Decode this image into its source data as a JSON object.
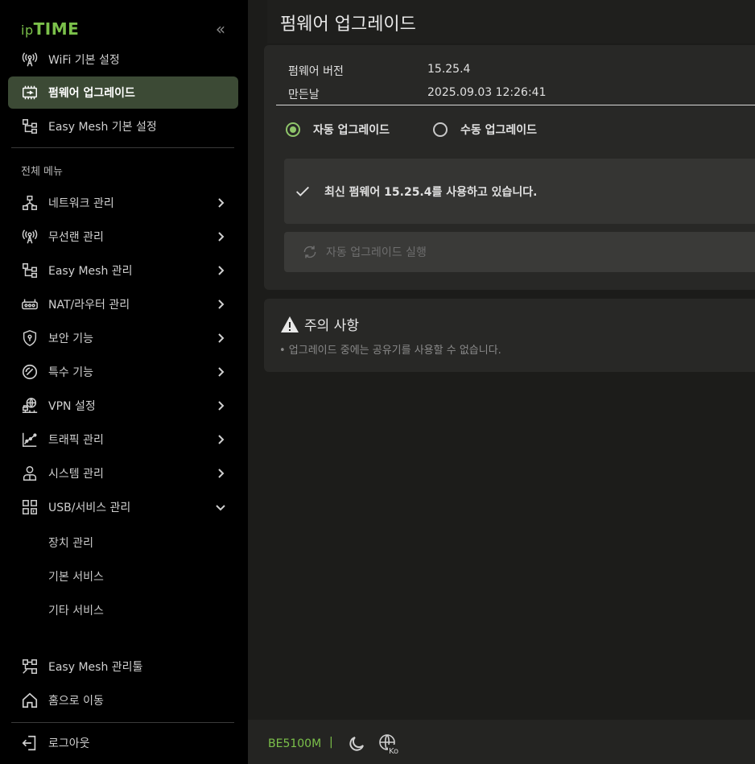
{
  "brand": {
    "logo_prefix": "ip",
    "logo_main": "TIME",
    "accent": "#7bc04a"
  },
  "sidebar": {
    "collapse_glyph": "«",
    "quick": [
      {
        "label": "WiFi 기본 설정",
        "icon": "antenna-icon"
      },
      {
        "label": "펌웨어 업그레이드",
        "icon": "firmware-chip-icon",
        "active": true
      },
      {
        "label": "Easy Mesh 기본 설정",
        "icon": "mesh-tree-icon"
      }
    ],
    "all_menu_label": "전체 메뉴",
    "menu": [
      {
        "label": "네트워크 관리",
        "icon": "network-icon"
      },
      {
        "label": "무선랜 관리",
        "icon": "antenna-icon"
      },
      {
        "label": "Easy Mesh 관리",
        "icon": "mesh-tree-icon"
      },
      {
        "label": "NAT/라우터 관리",
        "icon": "router-icon"
      },
      {
        "label": "보안 기능",
        "icon": "shield-icon"
      },
      {
        "label": "특수 기능",
        "icon": "gauge-icon"
      },
      {
        "label": "VPN 설정",
        "icon": "vpn-globe-icon"
      },
      {
        "label": "트래픽 관리",
        "icon": "traffic-chart-icon"
      },
      {
        "label": "시스템 관리",
        "icon": "system-user-icon"
      },
      {
        "label": "USB/서비스 관리",
        "icon": "usb-services-icon",
        "expanded": true
      }
    ],
    "sub_items": [
      "장치 관리",
      "기본 서비스",
      "기타 서비스"
    ],
    "bottom": [
      {
        "label": "Easy Mesh 관리툴",
        "icon": "mesh-tool-icon"
      },
      {
        "label": "홈으로 이동",
        "icon": "home-icon"
      },
      {
        "label": "로그아웃",
        "icon": "logout-icon"
      }
    ]
  },
  "main": {
    "title": "펌웨어 업그레이드",
    "firmware": {
      "version_label": "펌웨어 버전",
      "version_value": "15.25.4",
      "build_label": "만든날",
      "build_value": "2025.09.03 12:26:41"
    },
    "modes": [
      {
        "label": "자동 업그레이드",
        "checked": true
      },
      {
        "label": "수동 업그레이드",
        "checked": false
      }
    ],
    "status_message": "최신 펌웨어 15.25.4를 사용하고 있습니다.",
    "run_button_label": "자동 업그레이드 실행",
    "caution": {
      "title": "주의 사항",
      "items": [
        "• 업그레이드 중에는 공유기를 사용할 수 없습니다."
      ]
    }
  },
  "footer": {
    "model": "BE5100M",
    "separator": "|",
    "language_badge": "Ko"
  }
}
